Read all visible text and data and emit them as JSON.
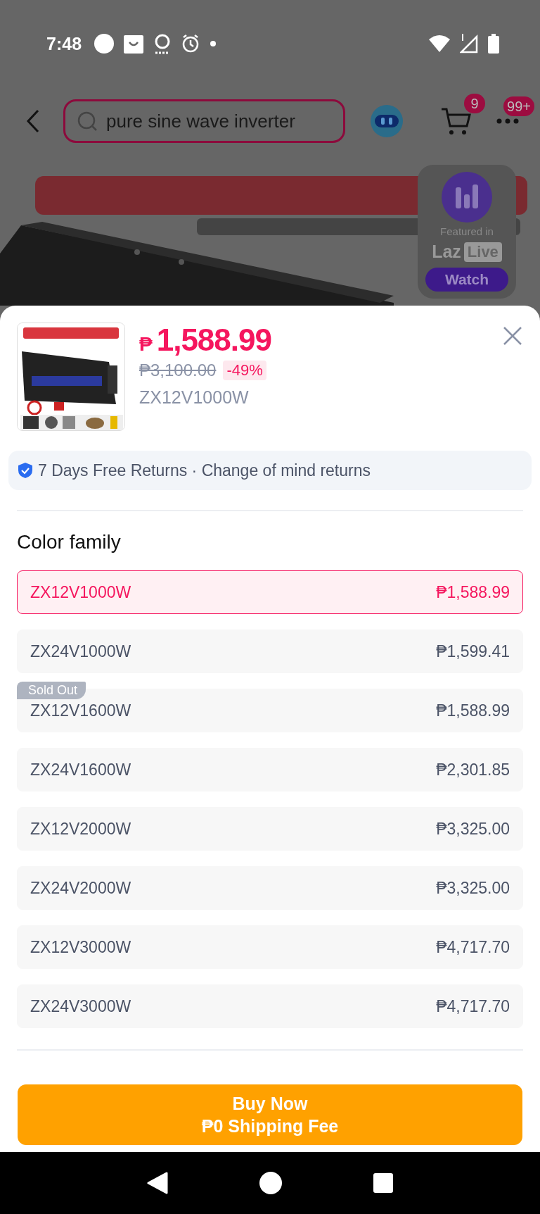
{
  "status_bar": {
    "time": "7:48"
  },
  "top_nav": {
    "search": {
      "value": "pure sine wave inverter"
    },
    "cart_badge": "9",
    "more_badge": "99+"
  },
  "live_widget": {
    "caption": "Featured in",
    "brand": "Laz",
    "brand_tag": "Live",
    "button": "Watch"
  },
  "product": {
    "price_symbol": "₱",
    "price": "1,588.99",
    "original_price": "₱3,100.00",
    "discount": "-49%",
    "variant": "ZX12V1000W"
  },
  "returns": {
    "text": "7 Days Free Returns · Change of mind returns"
  },
  "color_family": {
    "title": "Color family",
    "options": [
      {
        "name": "ZX12V1000W",
        "price": "₱1,588.99",
        "selected": true
      },
      {
        "name": "ZX24V1000W",
        "price": "₱1,599.41",
        "selected": false
      },
      {
        "name": "ZX12V1600W",
        "price": "₱1,588.99",
        "selected": false,
        "badge": "Sold Out"
      },
      {
        "name": "ZX24V1600W",
        "price": "₱2,301.85",
        "selected": false
      },
      {
        "name": "ZX12V2000W",
        "price": "₱3,325.00",
        "selected": false
      },
      {
        "name": "ZX24V2000W",
        "price": "₱3,325.00",
        "selected": false
      },
      {
        "name": "ZX12V3000W",
        "price": "₱4,717.70",
        "selected": false
      },
      {
        "name": "ZX24V3000W",
        "price": "₱4,717.70",
        "selected": false
      }
    ]
  },
  "buy_button": {
    "lines": [
      "Buy Now",
      "₱0 Shipping Fee"
    ]
  }
}
